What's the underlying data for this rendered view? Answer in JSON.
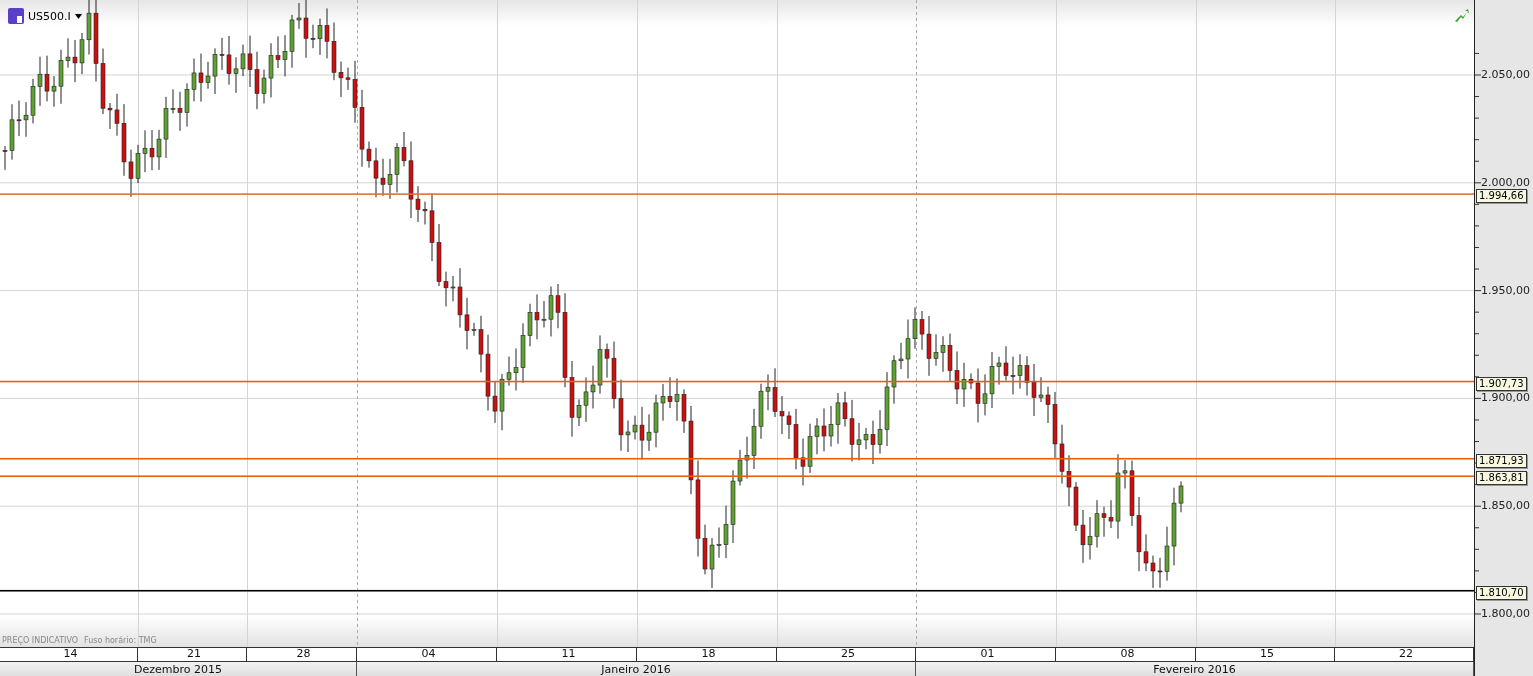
{
  "symbol": {
    "label": "US500.I"
  },
  "footnote": [
    "PREÇO INDICATIVO",
    "Fuso horário: TMG"
  ],
  "price_axis": {
    "ticks": [
      "2.050,00",
      "2.000,00",
      "1.950,00",
      "1.900,00",
      "1.850,00",
      "1.800,00"
    ]
  },
  "price_lines": [
    {
      "label": "1.994,66",
      "color": "#d9743a"
    },
    {
      "label": "1.907,73",
      "color": "#e8600a"
    },
    {
      "label": "1.871,93",
      "color": "#e8600a"
    },
    {
      "label": "1.863,81",
      "color": "#e8600a"
    },
    {
      "label": "1.810,70",
      "color": "#000000"
    }
  ],
  "days": [
    {
      "label": "14"
    },
    {
      "label": "21"
    },
    {
      "label": "28"
    },
    {
      "label": "04"
    },
    {
      "label": "11"
    },
    {
      "label": "18"
    },
    {
      "label": "25"
    },
    {
      "label": "01"
    },
    {
      "label": "08"
    },
    {
      "label": "15"
    },
    {
      "label": "22"
    }
  ],
  "months": [
    "Dezembro 2015",
    "Janeiro 2016",
    "Fevereiro 2016"
  ]
}
